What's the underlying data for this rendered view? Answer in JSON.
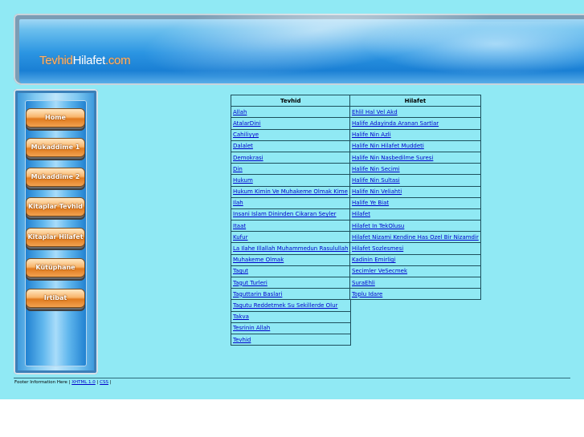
{
  "logo": {
    "part1": "Tevhid",
    "part2": "Hilafet",
    "part3": ".com"
  },
  "nav": [
    "Home",
    "Mukaddime 1",
    "Mukaddime 2",
    "Kitaplar Tevhid",
    "Kitaplar Hilafet",
    "Kütüphane",
    "Irtibat"
  ],
  "tevhid": {
    "header": "Tevhid",
    "items": [
      "Allah",
      "AtalarDini",
      "Cahiliyye",
      "Dalalet",
      "Demokrasi",
      "Din",
      "Hukum",
      "Hukum Kimin Ve Muhakeme Olmak Kime",
      "Ilah",
      "Insani Islam Dininden Cikaran Seyler",
      "Itaat",
      "Kufur",
      "La Ilahe Illallah Muhammedun Rasulullah",
      "Muhakeme Olmak",
      "Tagut",
      "Tagut Turleri",
      "Taguttarin Baslari",
      "Tagutu Reddetmek Su Sekillerde Olur",
      "Takva",
      "Tesrinin Allah",
      "Tevhid"
    ]
  },
  "hilafet": {
    "header": "Hilafet",
    "items": [
      "Ehlil Hal Vel Akd",
      "Halife Adayinda Aranan Sartlar",
      "Halife Nin Azli",
      "Halife Nin Hilafet Muddeti",
      "Halife Nin Nasbedilme Suresi",
      "Halife Nin Secimi",
      "Halife Nin Sultasi",
      "Halife Nin Veliahti",
      "Halife Ye Biat",
      "Hilafet",
      "Hilafet In TekOlusu",
      "Hilafet Nizami Kendine Has Ozel Bir Nizamdir",
      "Hilafet Sozlesmesi",
      "Kadinin Emirligi",
      "Secimler VeSecmek",
      "SuraEhli",
      "Toplu Idare"
    ]
  },
  "footer": {
    "text": "Footer Information Here |",
    "link1": "XHTML 1.0",
    "sep": "|",
    "link2": "CSS",
    "end": "|"
  }
}
